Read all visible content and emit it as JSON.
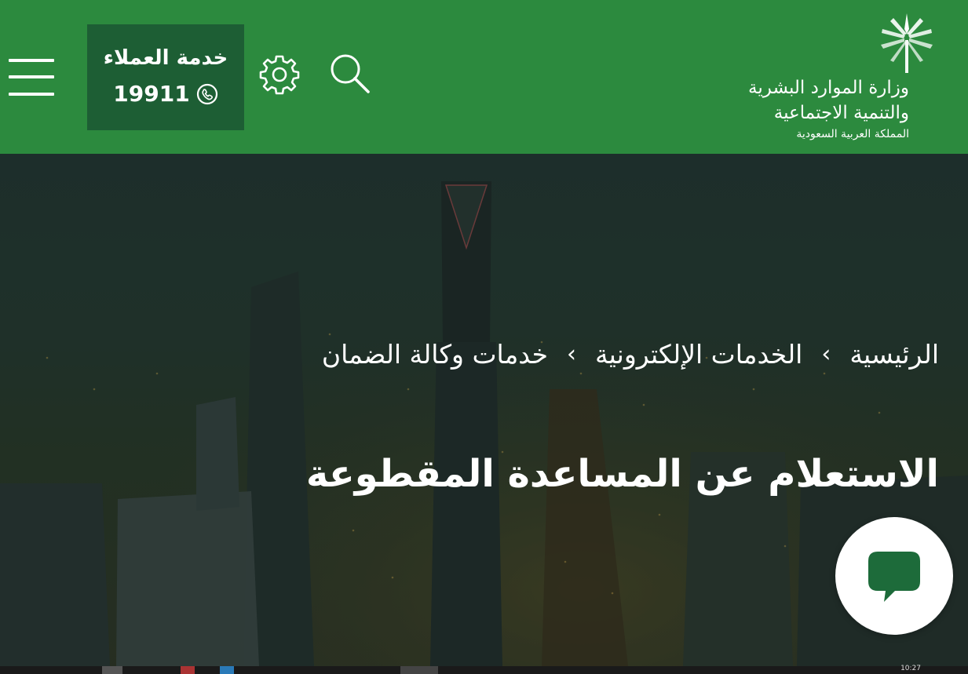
{
  "header": {
    "menu_icon": "hamburger-menu-icon",
    "customer_service": {
      "label": "خدمة العملاء",
      "phone": "19911",
      "icon": "phone-icon"
    },
    "settings_icon": "gear-icon",
    "search_icon": "search-icon",
    "logo": {
      "line1": "وزارة الموارد البشرية",
      "line2": "والتنمية الاجتماعية",
      "line3": "المملكة العربية السعودية"
    }
  },
  "breadcrumb": {
    "items": [
      "الرئيسية",
      "الخدمات الإلكترونية",
      "خدمات وكالة الضمان"
    ],
    "separator_icon": "chevron-left-icon"
  },
  "page": {
    "title": "الاستعلام عن المساعدة المقطوعة"
  },
  "chat": {
    "icon": "chat-bubble-icon"
  },
  "taskbar": {
    "clock": "10:27"
  },
  "colors": {
    "header_bg": "#2c8a3e",
    "customer_service_bg": "#1d5e34",
    "chat_icon": "#1d6b3a",
    "text": "#ffffff"
  }
}
